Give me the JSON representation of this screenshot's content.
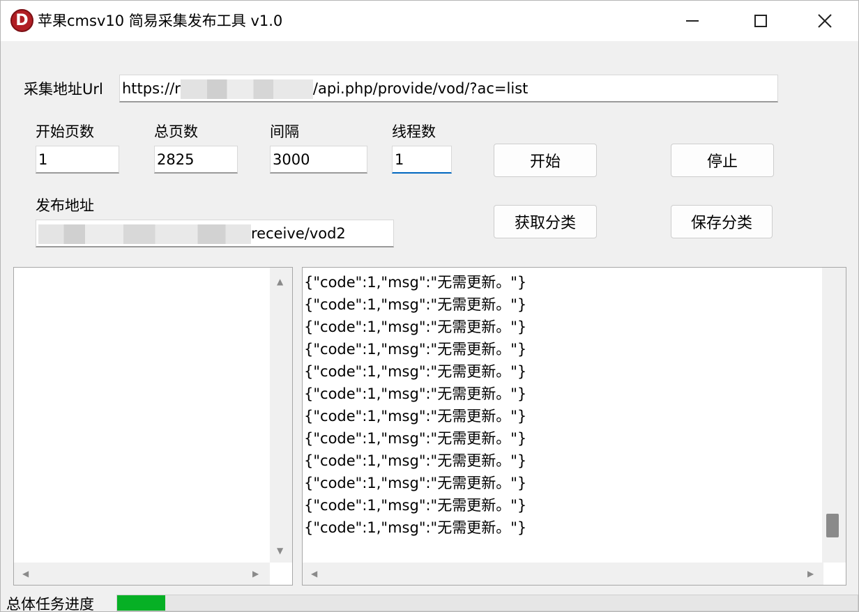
{
  "window": {
    "title": "苹果cmsv10 简易采集发布工具 v1.0",
    "icon": "red-d-logo-icon",
    "controls": [
      "minimize-icon",
      "maximize-icon",
      "close-icon"
    ]
  },
  "collect": {
    "url_label": "采集地址Url",
    "url_prefix": "https://r",
    "url_suffix": "/api.php/provide/vod/?ac=list"
  },
  "params": {
    "start_page_label": "开始页数",
    "start_page_value": "1",
    "total_pages_label": "总页数",
    "total_pages_value": "2825",
    "interval_label": "间隔",
    "interval_value": "3000",
    "threads_label": "线程数",
    "threads_value": "1"
  },
  "publish": {
    "label": "发布地址",
    "value_suffix": "receive/vod2"
  },
  "buttons": {
    "start": "开始",
    "stop": "停止",
    "fetch_categories": "获取分类",
    "save_categories": "保存分类"
  },
  "log_lines": [
    "{\"code\":1,\"msg\":\"无需更新。\"}",
    "{\"code\":1,\"msg\":\"无需更新。\"}",
    "{\"code\":1,\"msg\":\"无需更新。\"}",
    "{\"code\":1,\"msg\":\"无需更新。\"}",
    "{\"code\":1,\"msg\":\"无需更新。\"}",
    "{\"code\":1,\"msg\":\"无需更新。\"}",
    "{\"code\":1,\"msg\":\"无需更新。\"}",
    "{\"code\":1,\"msg\":\"无需更新。\"}",
    "{\"code\":1,\"msg\":\"无需更新。\"}",
    "{\"code\":1,\"msg\":\"无需更新。\"}",
    "{\"code\":1,\"msg\":\"无需更新。\"}",
    "{\"code\":1,\"msg\":\"无需更新。\"}"
  ],
  "progress": {
    "label": "总体任务进度",
    "fraction": 0.065,
    "color": "#06b025"
  }
}
